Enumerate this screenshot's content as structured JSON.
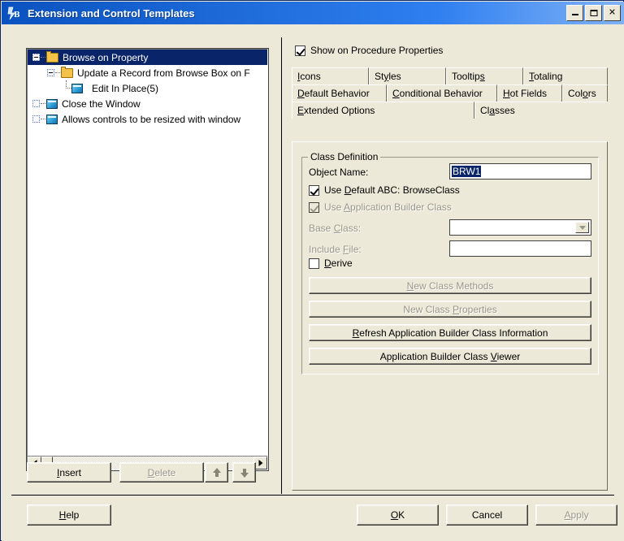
{
  "window": {
    "title": "Extension and Control Templates",
    "icon": "clarion-template-icon",
    "controls": {
      "minimize": "minimize-icon",
      "maximize": "maximize-icon",
      "close": "close-icon"
    }
  },
  "tree": {
    "items": [
      {
        "label": "Browse on Property",
        "icon": "folder-icon",
        "indent": 0,
        "expander": "minus",
        "selected": true
      },
      {
        "label": "Update a Record from Browse Box on F",
        "icon": "folder-icon",
        "indent": 1,
        "expander": "minus",
        "selected": false
      },
      {
        "label": "Edit In Place(5)",
        "icon": "window-icon",
        "indent": 2,
        "expander": "none",
        "selected": false
      },
      {
        "label": "Close the Window",
        "icon": "window-icon",
        "indent": 0,
        "expander": "empty",
        "selected": false
      },
      {
        "label": "Allows controls to be resized with window",
        "icon": "window-icon",
        "indent": 0,
        "expander": "empty",
        "selected": false
      }
    ]
  },
  "tree_toolbar": {
    "insert": {
      "label": "Insert",
      "accel": "I",
      "enabled": true
    },
    "delete": {
      "label": "Delete",
      "accel": "D",
      "enabled": false
    },
    "move_up": {
      "label": "move-up",
      "enabled": true
    },
    "move_down": {
      "label": "move-down",
      "enabled": true
    }
  },
  "right": {
    "show_on_procedure_properties": {
      "label": "Show on Procedure Properties",
      "checked": true
    },
    "tabs": [
      {
        "label": "Icons",
        "accel": "I",
        "row": 0,
        "active": false
      },
      {
        "label": "Styles",
        "accel": "y",
        "row": 0,
        "active": false
      },
      {
        "label": "Tooltips",
        "accel": "p",
        "row": 0,
        "active": false
      },
      {
        "label": "Totaling",
        "accel": "T",
        "row": 0,
        "active": false
      },
      {
        "label": "Default Behavior",
        "accel": "D",
        "row": 1,
        "active": false
      },
      {
        "label": "Conditional Behavior",
        "accel": "C",
        "row": 1,
        "active": false
      },
      {
        "label": "Hot Fields",
        "accel": "H",
        "row": 1,
        "active": false
      },
      {
        "label": "Colors",
        "accel": "o",
        "row": 1,
        "active": false
      },
      {
        "label": "Extended Options",
        "accel": "E",
        "row": 2,
        "active": false
      },
      {
        "label": "Classes",
        "accel": "a",
        "row": 2,
        "active": true
      }
    ],
    "group": {
      "title": "Class Definition",
      "object_name": {
        "label": "Object Name:",
        "value": "BRW1",
        "selected": true
      },
      "use_default_abc": {
        "label": "Use Default ABC: BrowseClass",
        "accel": "D",
        "checked": true,
        "enabled": true
      },
      "use_app_builder_class": {
        "label": "Use Application Builder Class",
        "accel": "A",
        "checked": true,
        "enabled": false
      },
      "base_class": {
        "label": "Base Class:",
        "accel": "C",
        "value": "",
        "enabled": false
      },
      "include_file": {
        "label": "Include File:",
        "accel": "F",
        "value": "",
        "enabled": false
      },
      "derive": {
        "label": "Derive",
        "accel": "D",
        "checked": false,
        "enabled": true
      },
      "buttons": [
        {
          "label": "New Class Methods",
          "accel": "N",
          "enabled": false
        },
        {
          "label": "New Class Properties",
          "accel": "P",
          "enabled": false
        },
        {
          "label": "Refresh Application Builder Class Information",
          "accel": "R",
          "enabled": true
        },
        {
          "label": "Application Builder Class Viewer",
          "accel": "V",
          "enabled": true
        }
      ]
    }
  },
  "footer": {
    "help": {
      "label": "Help",
      "accel": "H",
      "enabled": true
    },
    "ok": {
      "label": "OK",
      "accel": "O",
      "enabled": true,
      "default": true
    },
    "cancel": {
      "label": "Cancel",
      "enabled": true
    },
    "apply": {
      "label": "Apply",
      "accel": "A",
      "enabled": false
    }
  },
  "colors": {
    "title_bar_start": "#0a52c0",
    "title_bar_end": "#7fb2f5",
    "face": "#ece9d8",
    "selection": "#0a246a",
    "disabled_text": "#9a9788"
  }
}
